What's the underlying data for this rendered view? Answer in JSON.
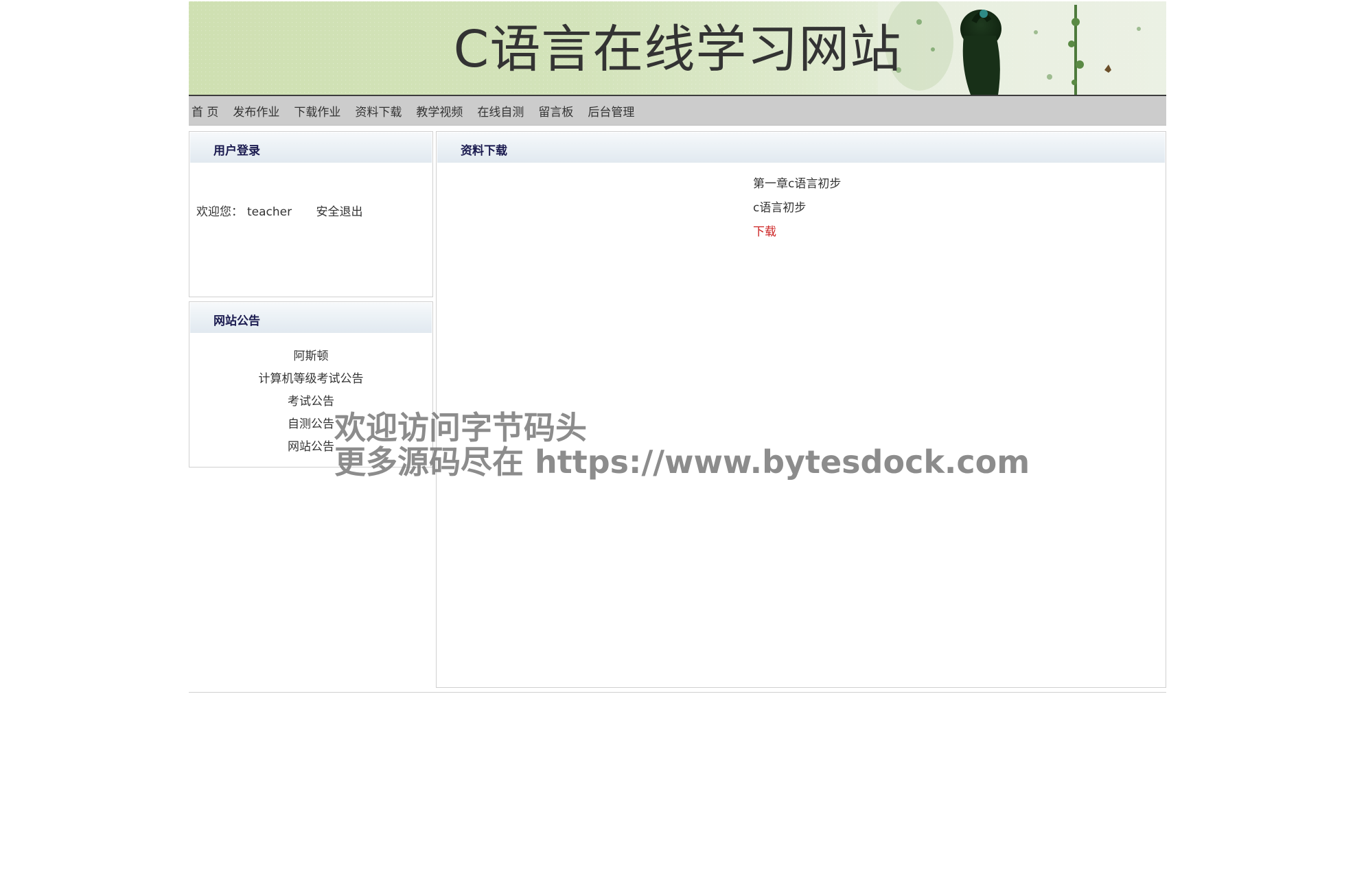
{
  "header": {
    "title": "C语言在线学习网站"
  },
  "nav": {
    "items": [
      "首 页",
      "发布作业",
      "下载作业",
      "资料下载",
      "教学视频",
      "在线自测",
      "留言板",
      "后台管理"
    ]
  },
  "login_panel": {
    "title": "用户登录",
    "welcome_label": "欢迎您：",
    "username": "teacher",
    "logout_label": "安全退出"
  },
  "notice_panel": {
    "title": "网站公告",
    "items": [
      "阿斯顿",
      "计算机等级考试公告",
      "考试公告",
      "自测公告",
      "网站公告"
    ]
  },
  "content_panel": {
    "title": "资料下载",
    "resource": {
      "title": "第一章c语言初步",
      "description": "c语言初步",
      "download_label": "下载"
    }
  },
  "watermark": {
    "line1": "欢迎访问字节码头",
    "line2": "更多源码尽在  https://www.bytesdock.com"
  },
  "colors": {
    "nav_bg": "#cccccc",
    "panel_title": "#1a1a4f",
    "download_link": "#cc2222"
  }
}
